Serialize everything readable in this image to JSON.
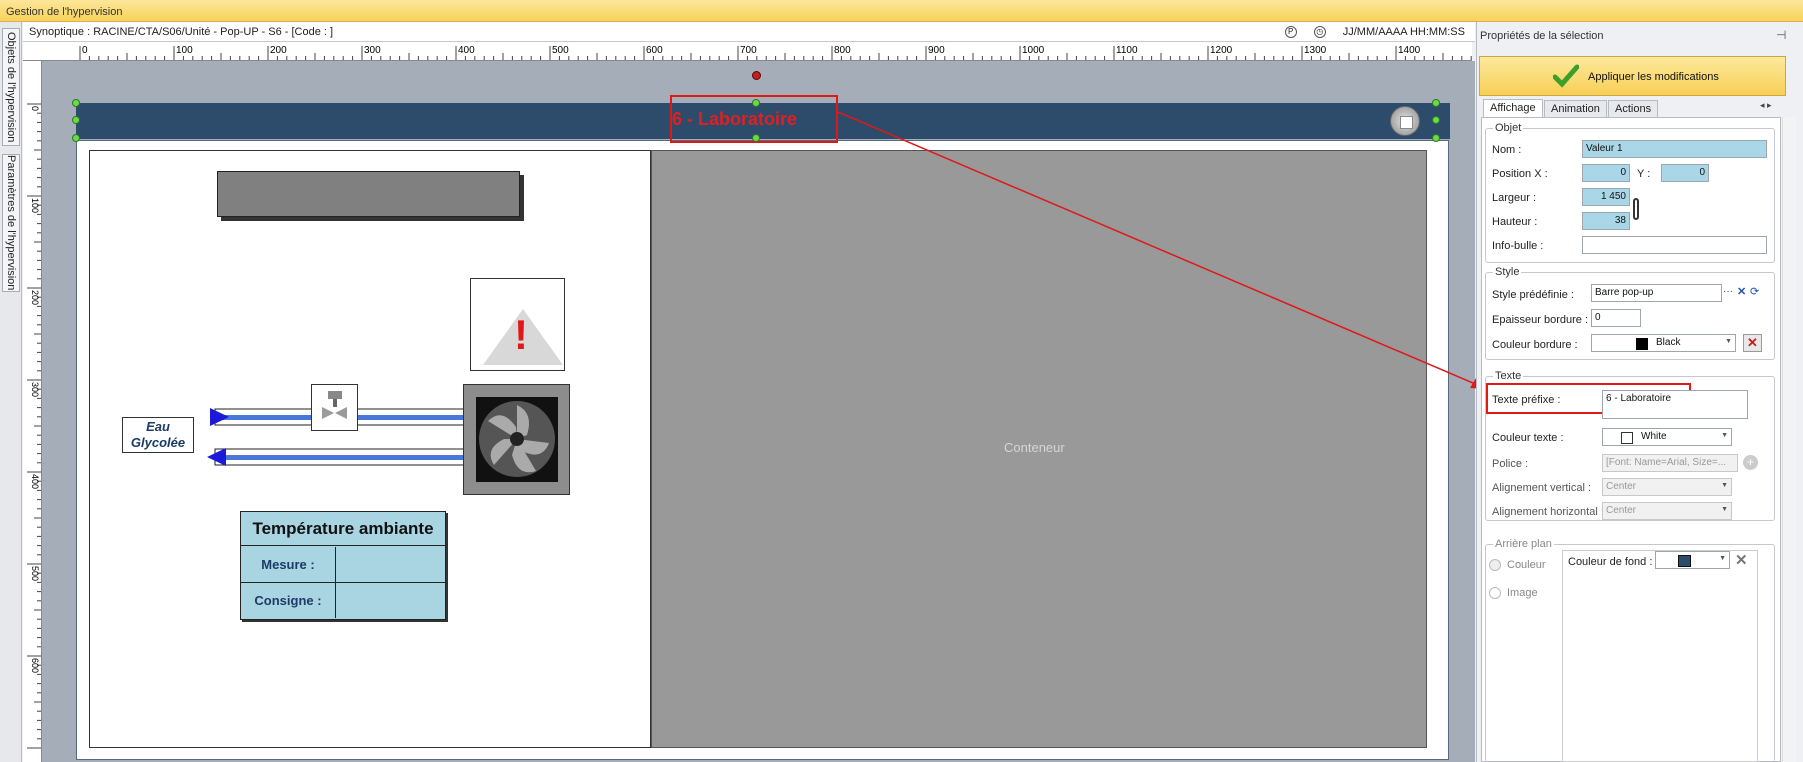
{
  "window": {
    "title": "Gestion de l'hypervision"
  },
  "side_tabs": [
    "Objets de l'hypervision",
    "Paramètres de l'hypervision"
  ],
  "synoptic": {
    "path": "Synoptique : RACINE/CTA/S06/Unité - Pop-UP - S6 - [Code : ]",
    "icon1": "P",
    "icon2": "clock-icon",
    "datetime": "JJ/MM/AAAA HH:MM:SS"
  },
  "ruler": {
    "h_ticks": [
      "0",
      "100",
      "200",
      "300",
      "400",
      "500",
      "600",
      "700",
      "800",
      "900",
      "1000",
      "1100",
      "1200",
      "1300",
      "1400"
    ],
    "v_ticks": [
      "0",
      "100",
      "200",
      "300",
      "400",
      "500",
      "600"
    ]
  },
  "canvas": {
    "header_title": "6 - Laboratoire",
    "conteneur_label": "Conteneur",
    "eau_label_1": "Eau",
    "eau_label_2": "Glycolée",
    "temp_title": "Température ambiante",
    "mesure_label": "Mesure :",
    "consigne_label": "Consigne :",
    "alert_glyph": "!"
  },
  "colors": {
    "header": "#2d4b6a",
    "selection": "#e01818",
    "accent": "#f7cf55",
    "field_blue": "#a9d7e8"
  },
  "properties": {
    "title": "Propriétés de la sélection",
    "apply_label": "Appliquer les modifications",
    "tabs": [
      "Affichage",
      "Animation",
      "Actions"
    ],
    "active_tab": "Affichage",
    "objet": {
      "legend": "Objet",
      "nom_label": "Nom :",
      "nom_value": "Valeur 1",
      "posx_label": "Position X :",
      "posx_value": "0",
      "y_label": "Y :",
      "y_value": "0",
      "largeur_label": "Largeur :",
      "largeur_value": "1 450",
      "hauteur_label": "Hauteur :",
      "hauteur_value": "38",
      "infobulle_label": "Info-bulle :",
      "infobulle_value": ""
    },
    "style": {
      "legend": "Style",
      "predef_label": "Style prédéfinie :",
      "predef_value": "Barre pop-up",
      "epaisseur_label": "Epaisseur bordure :",
      "epaisseur_value": "0",
      "couleur_label": "Couleur bordure :",
      "couleur_value": "Black"
    },
    "texte": {
      "legend": "Texte",
      "prefixe_label": "Texte préfixe :",
      "prefixe_value": "6 - Laboratoire",
      "couleur_label": "Couleur texte :",
      "couleur_value": "White",
      "police_label": "Police :",
      "police_value": "[Font: Name=Arial, Size=...",
      "valign_label": "Alignement vertical :",
      "valign_value": "Center",
      "halign_label": "Alignement horizontal :",
      "halign_value": "Center"
    },
    "arriere": {
      "legend": "Arrière plan",
      "couleur_radio": "Couleur",
      "image_radio": "Image",
      "fond_label": "Couleur de fond :"
    }
  }
}
